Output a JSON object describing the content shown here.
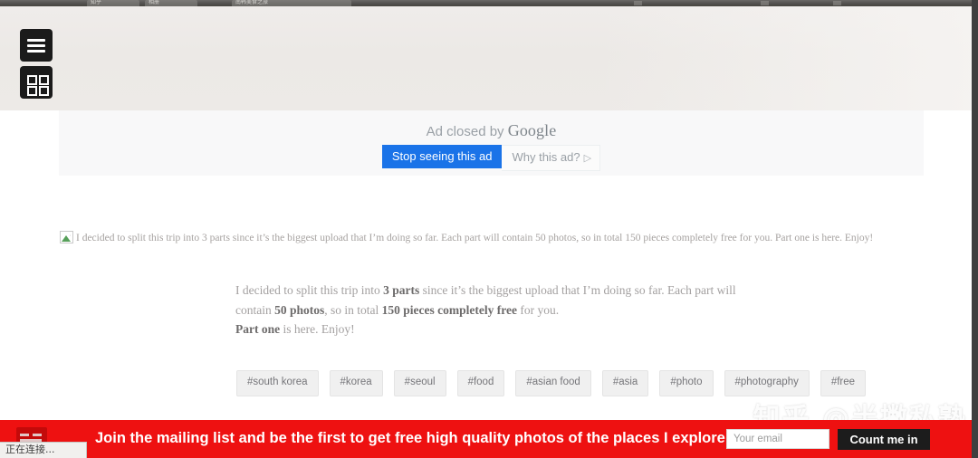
{
  "window": {
    "tabs": [
      {
        "label": "知乎"
      },
      {
        "label": "相册"
      },
      {
        "label": "南韩美食之旅"
      }
    ]
  },
  "hero": {
    "menu_button": "menu-icon",
    "grid_button": "grid-icon"
  },
  "ad": {
    "closed_prefix": "Ad closed by ",
    "brand": "Google",
    "stop_label": "Stop seeing this ad",
    "why_label": "Why this ad?",
    "why_glyph": "▷",
    "accent_color": "#1a73e8"
  },
  "article": {
    "broken_line": "I decided to split this trip into 3 parts since it’s the biggest upload that I’m doing so far. Each part will contain 50 photos, so in total 150 pieces completely free for you. Part one is here. Enjoy!",
    "p1_a": "I decided to split this trip into ",
    "p1_b": "3 parts",
    "p1_c": " since it’s the biggest upload that I’m doing so far. Each part will contain ",
    "p1_d": "50 photos",
    "p1_e": ", so in total ",
    "p1_f": "150 pieces completely free",
    "p1_g": " for you.",
    "p2_a": "Part one",
    "p2_b": " is here. Enjoy!"
  },
  "tags": [
    "#south korea",
    "#korea",
    "#seoul",
    "#food",
    "#asian food",
    "#asia",
    "#photo",
    "#photography",
    "#free"
  ],
  "watermark": {
    "text": "知乎 @半撇私塾"
  },
  "mail_banner": {
    "title": "Join the mailing list and be the first to get free high quality photos of the places I explore",
    "email_placeholder": "Your email",
    "email_value": "",
    "submit_label": "Count me in",
    "background_color": "#ee1111"
  },
  "status": {
    "text": "正在连接..."
  }
}
